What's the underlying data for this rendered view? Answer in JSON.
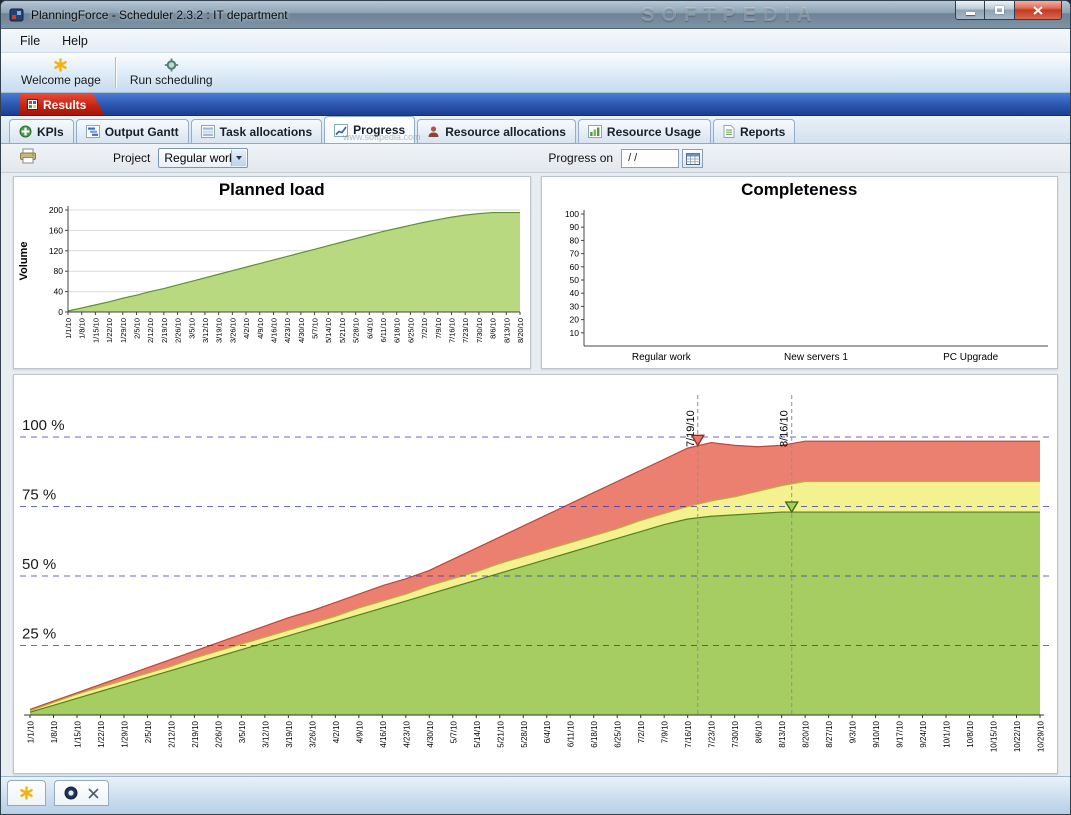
{
  "window": {
    "title": "PlanningForce - Scheduler 2.3.2 : IT department",
    "watermark": "SOFTPEDIA",
    "watermark_small": "www.softpedia.com"
  },
  "menu": {
    "items": [
      {
        "label": "File"
      },
      {
        "label": "Help"
      }
    ]
  },
  "toolbar": {
    "welcome_label": "Welcome page",
    "run_label": "Run scheduling"
  },
  "results_tab": {
    "label": "Results"
  },
  "tabs": [
    {
      "label": "KPIs"
    },
    {
      "label": "Output Gantt"
    },
    {
      "label": "Task allocations"
    },
    {
      "label": "Progress",
      "active": true
    },
    {
      "label": "Resource allocations"
    },
    {
      "label": "Resource Usage"
    },
    {
      "label": "Reports"
    }
  ],
  "filters": {
    "project_label": "Project",
    "project_value": "Regular work",
    "progress_on_label": "Progress on",
    "date_value": "/ /"
  },
  "chart_data": [
    {
      "id": "planned_load",
      "type": "area",
      "title": "Planned load",
      "ylabel": "Volume",
      "ylim": [
        0,
        200
      ],
      "yticks": [
        0,
        40,
        80,
        120,
        160,
        200
      ],
      "x": [
        "1/1/10",
        "1/8/10",
        "1/15/10",
        "1/22/10",
        "1/29/10",
        "2/5/10",
        "2/12/10",
        "2/19/10",
        "2/26/10",
        "3/5/10",
        "3/12/10",
        "3/19/10",
        "3/26/10",
        "4/2/10",
        "4/9/10",
        "4/16/10",
        "4/23/10",
        "4/30/10",
        "5/7/10",
        "5/14/10",
        "5/21/10",
        "5/28/10",
        "6/4/10",
        "6/11/10",
        "6/18/10",
        "6/25/10",
        "7/2/10",
        "7/9/10",
        "7/16/10",
        "7/23/10",
        "7/30/10",
        "8/6/10",
        "8/13/10",
        "8/20/10"
      ],
      "values": [
        2,
        8,
        14,
        20,
        27,
        33,
        40,
        46,
        53,
        60,
        67,
        74,
        81,
        88,
        95,
        102,
        109,
        116,
        123,
        130,
        137,
        144,
        151,
        158,
        164,
        170,
        176,
        181,
        186,
        190,
        193,
        195,
        195,
        195
      ],
      "fill": "#b9d981",
      "stroke": "#5f8f33"
    },
    {
      "id": "completeness",
      "type": "bar",
      "title": "Completeness",
      "ylim": [
        0,
        100
      ],
      "yticks": [
        10,
        20,
        30,
        40,
        50,
        60,
        70,
        80,
        90,
        100
      ],
      "categories": [
        "Regular work",
        "New servers 1",
        "PC Upgrade"
      ],
      "values": [
        0,
        0,
        0
      ]
    },
    {
      "id": "progress",
      "type": "area",
      "title": "",
      "ylim": [
        0,
        100
      ],
      "yticks": [
        25,
        50,
        75,
        100
      ],
      "ytick_labels": [
        "25 %",
        "50 %",
        "75 %",
        "100 %"
      ],
      "values_are": "cumulative_top_percent",
      "x": [
        "1/1/10",
        "1/8/10",
        "1/15/10",
        "1/22/10",
        "1/29/10",
        "2/5/10",
        "2/12/10",
        "2/19/10",
        "2/26/10",
        "3/5/10",
        "3/12/10",
        "3/19/10",
        "3/26/10",
        "4/2/10",
        "4/9/10",
        "4/16/10",
        "4/23/10",
        "4/30/10",
        "5/7/10",
        "5/14/10",
        "5/21/10",
        "5/28/10",
        "6/4/10",
        "6/11/10",
        "6/18/10",
        "6/25/10",
        "7/2/10",
        "7/9/10",
        "7/16/10",
        "7/23/10",
        "7/30/10",
        "8/6/10",
        "8/13/10",
        "8/20/10",
        "8/27/10",
        "9/3/10",
        "9/10/10",
        "9/17/10",
        "9/24/10",
        "10/1/10",
        "10/8/10",
        "10/15/10",
        "10/22/10",
        "10/29/10"
      ],
      "series": [
        {
          "name": "green-area",
          "fill": "#a6cd62",
          "stroke": "#55801f",
          "values": [
            1,
            3.5,
            6,
            8.5,
            11,
            13.5,
            16,
            18.5,
            21,
            23.5,
            26,
            28.5,
            31,
            33.5,
            36,
            38.5,
            41,
            43.5,
            46,
            48.5,
            51,
            53.5,
            56,
            58.5,
            61,
            63.5,
            66,
            68.5,
            70.5,
            71.5,
            72,
            72.5,
            73,
            73,
            73,
            73,
            73,
            73,
            73,
            73,
            73,
            73,
            73,
            73
          ]
        },
        {
          "name": "yellow-area",
          "fill": "#f4f290",
          "stroke": "#b9b13a",
          "values": [
            1.5,
            4.5,
            7.5,
            10,
            12.5,
            15,
            17.5,
            20.5,
            23,
            25.5,
            28,
            30.5,
            33,
            35.5,
            38.5,
            41,
            43.5,
            46.5,
            49,
            51.5,
            54.5,
            57,
            59.5,
            62,
            64.5,
            67,
            70,
            72.5,
            75,
            77,
            78.5,
            80.5,
            82.5,
            84,
            84,
            84,
            84,
            84,
            84,
            84,
            84,
            84,
            84,
            84
          ]
        },
        {
          "name": "red-area",
          "fill": "#ec8070",
          "stroke": "#b9473a",
          "values": [
            2,
            5,
            8,
            11,
            14,
            17,
            20,
            23,
            26,
            29,
            32,
            35,
            37.5,
            40.5,
            43.5,
            46.5,
            49,
            52,
            56,
            60,
            64,
            68,
            72,
            76,
            80,
            84,
            88,
            92,
            96,
            98,
            97,
            96.5,
            97,
            98.5,
            98.5,
            98.5,
            98.5,
            98.5,
            98.5,
            98.5,
            98.5,
            98.5,
            98.5,
            98.5
          ]
        }
      ],
      "markers": [
        {
          "label": "7/19/10",
          "x_index": 28.43,
          "value": 97,
          "fill": "#e8766a",
          "stroke": "#8b2f24"
        },
        {
          "label": "8/16/10",
          "x_index": 32.43,
          "value": 73,
          "fill": "#a6cd62",
          "stroke": "#3f6b1a"
        }
      ],
      "grid_color": "#2a2ab0"
    }
  ]
}
